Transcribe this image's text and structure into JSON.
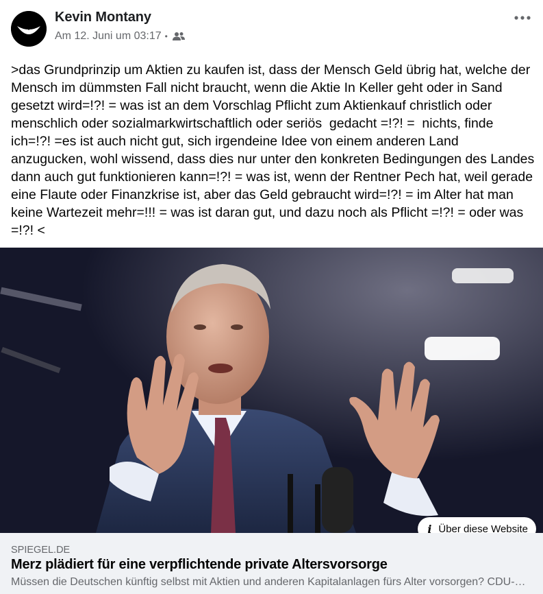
{
  "post": {
    "author": "Kevin Montany",
    "timestamp": "Am 12. Juni um 03:17",
    "separator": "•",
    "audience_icon": "friends-icon",
    "more_icon": "more-options-icon",
    "text": ">das Grundprinzip um Aktien zu kaufen ist, dass der Mensch Geld übrig hat, welche der Mensch im dümmsten Fall nicht braucht, wenn die Aktie In Keller geht oder in Sand gesetzt wird=!?! = was ist an dem Vorschlag Pflicht zum Aktienkauf christlich oder menschlich oder sozialmarkwirtschaftlich oder seriös  gedacht =!?! =  nichts, finde ich=!?! =es ist auch nicht gut, sich irgendeine Idee von einem anderen Land anzugucken, wohl wissend, dass dies nur unter den konkreten Bedingungen des Landes dann auch gut funktionieren kann=!?! = was ist, wenn der Rentner Pech hat, weil gerade eine Flaute oder Finanzkrise ist, aber das Geld gebraucht wird=!?! = im Alter hat man keine Wartezeit mehr=!!! = was ist daran gut, und dazu noch als Pflicht =!?! = oder was =!?! <"
  },
  "link_card": {
    "about_button_icon": "info-icon",
    "about_button_label": "Über diese Website",
    "domain": "SPIEGEL.DE",
    "title": "Merz plädiert für eine verpflichtende private Altersvorsorge",
    "description": "Müssen die Deutschen künftig selbst mit Aktien und anderen Kapitalanlagen fürs Alter vorsorgen? CDU-Politiker Friedrich Merz plädiert dafür."
  },
  "colors": {
    "secondary_text": "#65676b",
    "link_meta_bg": "#f0f2f5",
    "primary_text": "#050505"
  }
}
